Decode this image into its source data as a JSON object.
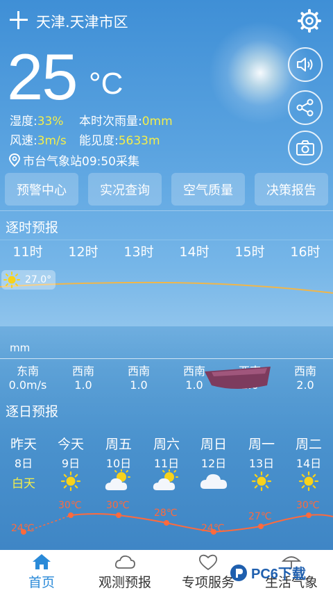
{
  "header": {
    "location": "天津.天津市区"
  },
  "current": {
    "temperature": "25",
    "unit": "°C",
    "humidity_label": "湿度:",
    "humidity_value": "33%",
    "rain_label": "本时次雨量:",
    "rain_value": "0mm",
    "wind_label": "风速:",
    "wind_value": "3m/s",
    "visibility_label": "能见度:",
    "visibility_value": "5633m",
    "station": "市台气象站09:50采集"
  },
  "quick_buttons": [
    "预警中心",
    "实况查询",
    "空气质量",
    "决策报告"
  ],
  "hourly": {
    "title": "逐时预报",
    "hours": [
      "11时",
      "12时",
      "13时",
      "14时",
      "15时",
      "16时"
    ],
    "current_temp": "27.0°",
    "rain_unit": "mm",
    "wind_dirs": [
      "东南",
      "西南",
      "西南",
      "西南",
      "西南",
      "西南"
    ],
    "wind_speeds": [
      "0.0m/s",
      "1.0",
      "1.0",
      "1.0",
      "1.0",
      "2.0"
    ]
  },
  "daily": {
    "title": "逐日预报",
    "days": [
      {
        "name": "昨天",
        "date": "8日",
        "weather": "白天",
        "icon": "text"
      },
      {
        "name": "今天",
        "date": "9日",
        "icon": "sun-icon"
      },
      {
        "name": "周五",
        "date": "10日",
        "icon": "partly-cloudy-icon"
      },
      {
        "name": "周六",
        "date": "11日",
        "icon": "partly-cloudy-icon"
      },
      {
        "name": "周日",
        "date": "12日",
        "icon": "cloud-icon"
      },
      {
        "name": "周一",
        "date": "13日",
        "icon": "sun-icon"
      },
      {
        "name": "周二",
        "date": "14日",
        "icon": "sun-icon"
      }
    ],
    "high_temps": [
      "24℃",
      "30℃",
      "30℃",
      "28℃",
      "24℃",
      "27℃",
      "30℃"
    ]
  },
  "nav": {
    "items": [
      "首页",
      "观测预报",
      "专项服务",
      "生活气象"
    ],
    "active_color": "#2a8ad8"
  },
  "watermark": "PC6下载"
}
